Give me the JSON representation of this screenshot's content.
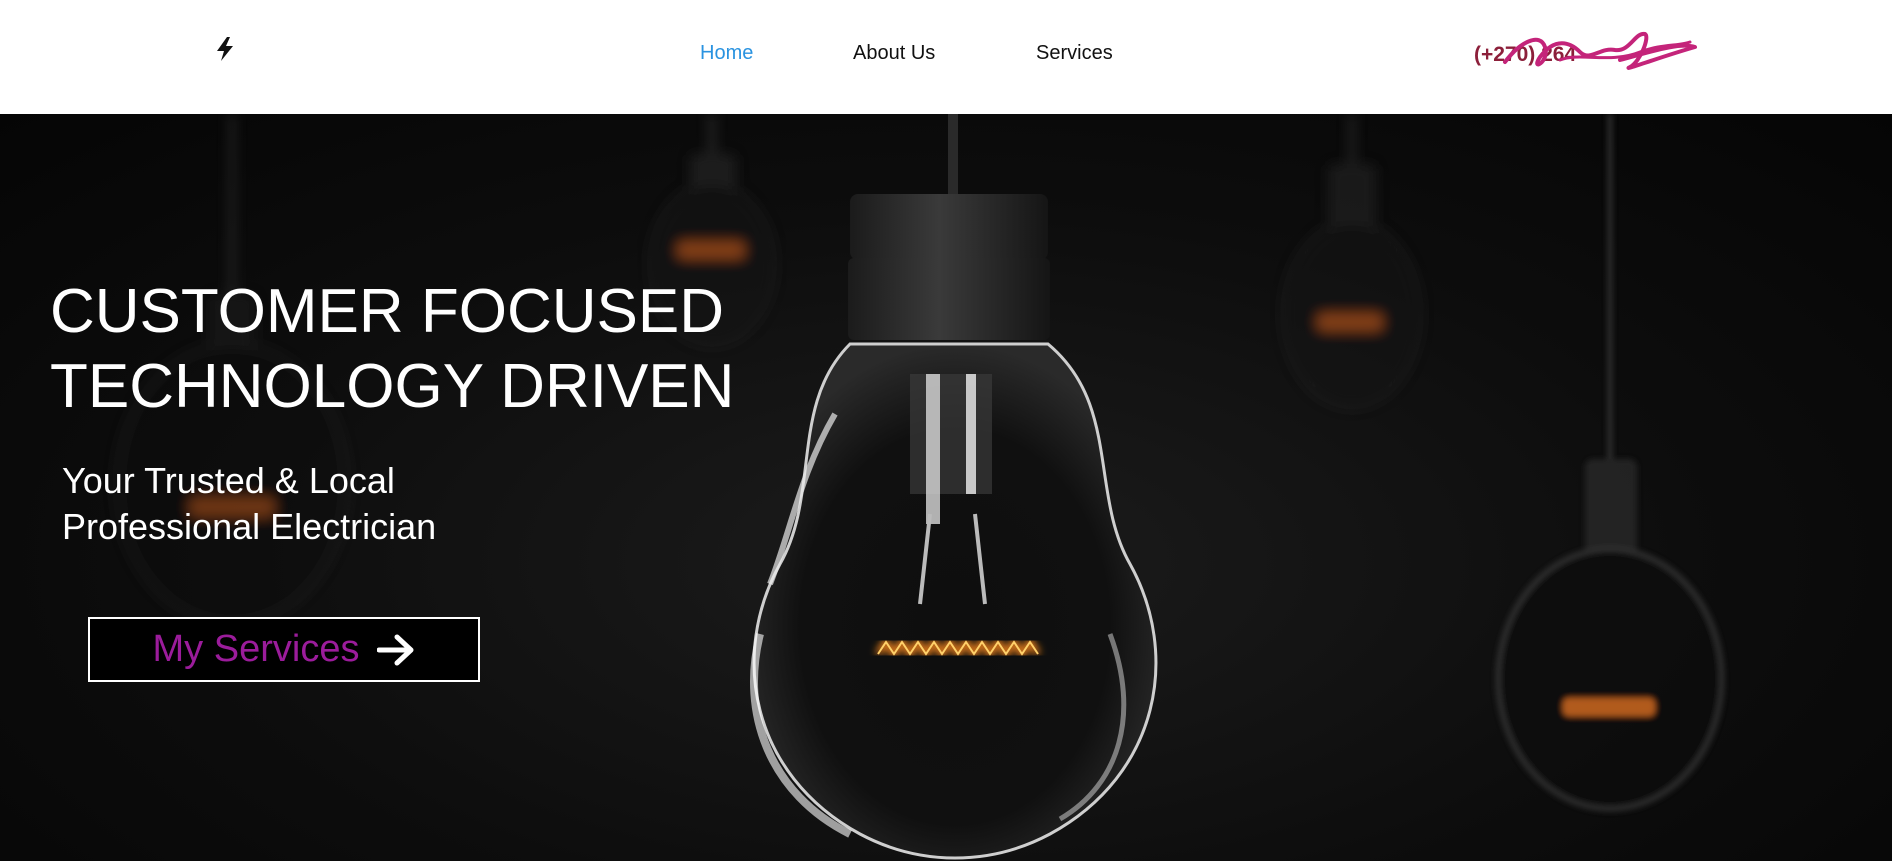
{
  "header": {
    "logo_icon": "lightning-bolt-icon",
    "nav": [
      {
        "label": "Home",
        "active": true
      },
      {
        "label": "About Us",
        "active": false
      },
      {
        "label": "Services",
        "active": false
      }
    ],
    "phone": "(+270) 264 ",
    "phone_color": "#8c1f3a",
    "active_color": "#2a93e0"
  },
  "hero": {
    "headline_line1": "CUSTOMER FOCUSED",
    "headline_line2": "TECHNOLOGY DRIVEN",
    "subhead_line1": "Your Trusted & Local",
    "subhead_line2": "Professional Electrician",
    "cta_label": "My Services",
    "cta_icon": "arrow-right-icon",
    "cta_label_color": "#9b1c9b",
    "background": "hanging light bulbs on black"
  }
}
